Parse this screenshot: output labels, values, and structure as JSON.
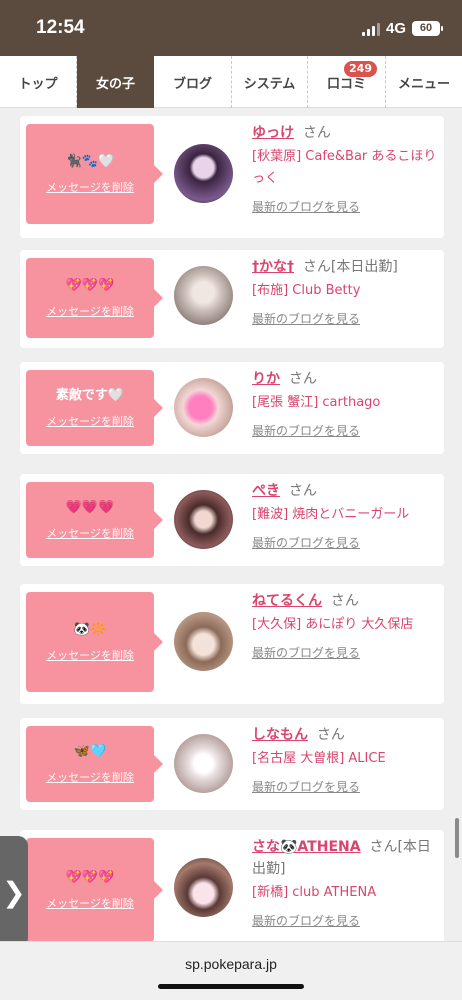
{
  "status": {
    "time": "12:54",
    "network": "4G",
    "battery": "60"
  },
  "nav": {
    "tabs": [
      {
        "label": "トップ"
      },
      {
        "label": "女の子",
        "active": true
      },
      {
        "label": "ブログ"
      },
      {
        "label": "システム"
      },
      {
        "label": "口コミ",
        "badge": "249"
      },
      {
        "label": "メニュー"
      }
    ]
  },
  "messages": [
    {
      "message": "🐈‍⬛🐾🤍",
      "delete_label": "メッセージを削除",
      "name": "ゆっけ",
      "honorific": "さん",
      "tag": "",
      "shop": "[秋葉原] Cafe&Bar あるこほりっく",
      "blog_label": "最新のブログを見る"
    },
    {
      "message": "💖💖💖",
      "delete_label": "メッセージを削除",
      "name": "†かな†",
      "honorific": "さん",
      "tag": "[本日出勤]",
      "shop": "[布施] Club Betty",
      "blog_label": "最新のブログを見る"
    },
    {
      "message": "素敵です🤍",
      "delete_label": "メッセージを削除",
      "name": "りか",
      "honorific": "さん",
      "tag": "",
      "shop": "[尾張 蟹江] carthago",
      "blog_label": "最新のブログを見る"
    },
    {
      "message": "💗💗💗",
      "delete_label": "メッセージを削除",
      "name": "ぺき",
      "honorific": "さん",
      "tag": "",
      "shop": "[難波] 焼肉とバニーガール",
      "blog_label": "最新のブログを見る"
    },
    {
      "message": "🐼🔆",
      "delete_label": "メッセージを削除",
      "name": "ねてるくん",
      "honorific": "さん",
      "tag": "",
      "shop": "[大久保] あにぽり 大久保店",
      "blog_label": "最新のブログを見る"
    },
    {
      "message": "🦋🩵",
      "delete_label": "メッセージを削除",
      "name": "しなもん",
      "honorific": "さん",
      "tag": "",
      "shop": "[名古屋 大曽根] ALICE",
      "blog_label": "最新のブログを見る"
    },
    {
      "message": "💖💖💖",
      "delete_label": "メッセージを削除",
      "name": "さな🐼ATHENA",
      "honorific": "さん",
      "tag": "[本日出勤]",
      "shop": "[新橋] club ATHENA",
      "blog_label": "最新のブログを見る"
    }
  ],
  "side_tab": {
    "label": "❯"
  },
  "browser": {
    "url": "sp.pokepara.jp"
  },
  "colors": {
    "header": "#5b4b3f",
    "message_box": "#f7939f",
    "link": "#d9456f"
  }
}
